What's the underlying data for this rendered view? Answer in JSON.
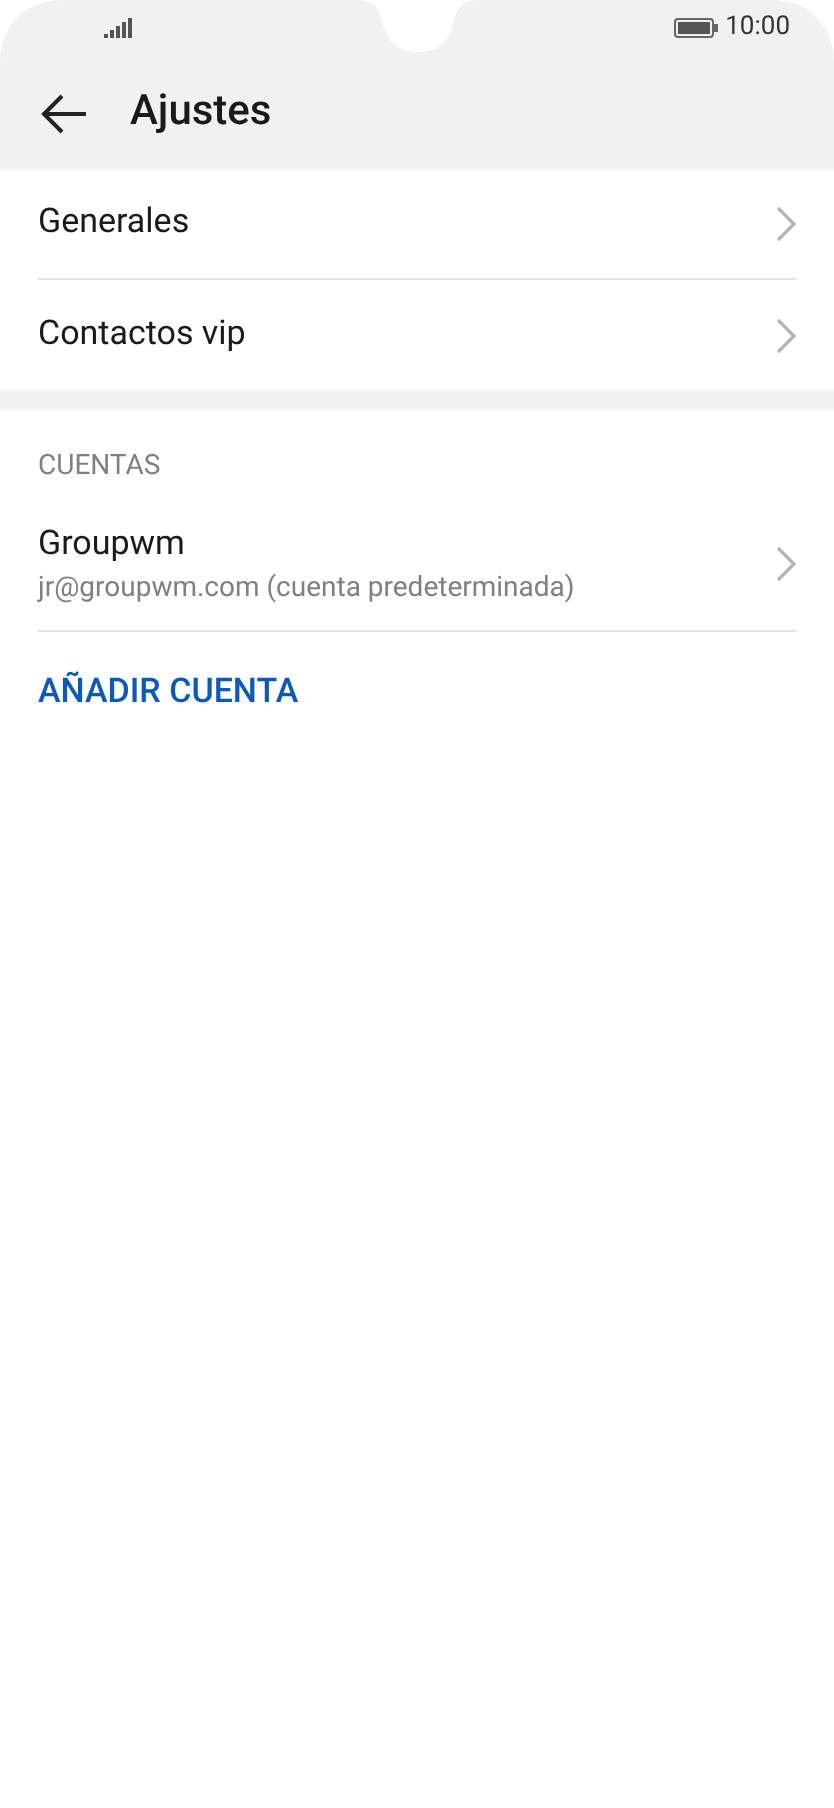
{
  "status_bar": {
    "time": "10:00"
  },
  "header": {
    "title": "Ajustes"
  },
  "menu_items": [
    {
      "label": "Generales"
    },
    {
      "label": "Contactos vip"
    }
  ],
  "accounts_section": {
    "heading": "CUENTAS",
    "accounts": [
      {
        "name": "Groupwm",
        "email": "jr@groupwm.com (cuenta predeterminada)"
      }
    ],
    "add_button": "AÑADIR CUENTA"
  }
}
